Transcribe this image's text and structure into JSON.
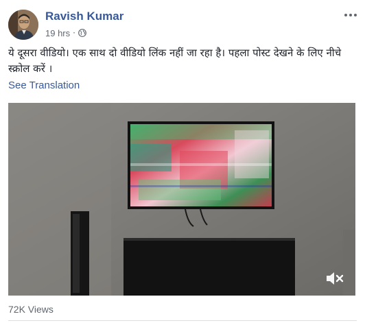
{
  "post": {
    "author": {
      "name": "Ravish Kumar",
      "avatar_icon": "profile-photo"
    },
    "timestamp": "19 hrs",
    "separator": "·",
    "privacy_icon": "globe-icon",
    "more_icon": "ellipsis-icon",
    "text": "ये दूसरा वीडियो। एक साथ दो वीडियो लिंक नहीं जा रहा है। पहला पोस्ट देखने के लिए नीचे स्क्रोल करें ।",
    "see_translation": "See Translation",
    "video": {
      "mute_icon": "muted-speaker-icon",
      "views": "72K Views"
    }
  },
  "colors": {
    "link": "#385898",
    "text": "#1d2129",
    "secondary": "#616770",
    "divider": "#dadde1"
  }
}
